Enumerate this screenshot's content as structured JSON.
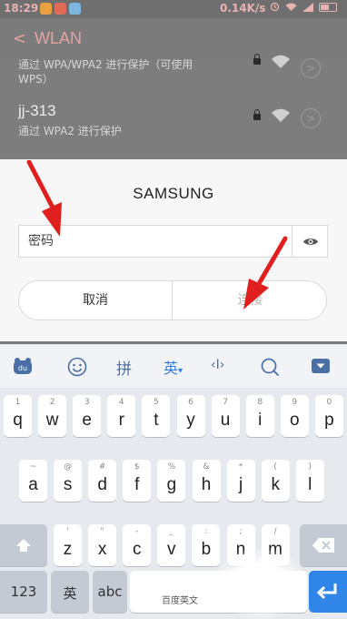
{
  "status_bar": {
    "time": "18:29",
    "speed": "0.14K/s",
    "app_icon_colors": [
      "#e8a040",
      "#e06a58",
      "#7fb6e0"
    ],
    "icons": [
      "alarm-icon",
      "wifi-icon",
      "signal-icon",
      "battery-icon"
    ]
  },
  "wlan": {
    "back_glyph": "<",
    "title": "WLAN",
    "network1_sub_line1": "通过 WPA/WPA2 进行保护（可使用",
    "network1_sub_line2": "WPS）",
    "network2_name": "jj-313",
    "network2_sub": "通过 WPA2 进行保护",
    "info_glyph": ">"
  },
  "dialog": {
    "title": "SAMSUNG",
    "password_placeholder": "密码",
    "cancel_label": "取消",
    "connect_label": "连接"
  },
  "ime_bar": {
    "pinyin_label": "拼",
    "english_label": "英",
    "english_arrow": "▾",
    "cursor_label": "‹I›"
  },
  "keyboard": {
    "row1": [
      {
        "main": "q",
        "sub": "1"
      },
      {
        "main": "w",
        "sub": "2"
      },
      {
        "main": "e",
        "sub": "3"
      },
      {
        "main": "r",
        "sub": "4"
      },
      {
        "main": "t",
        "sub": "5"
      },
      {
        "main": "y",
        "sub": "6"
      },
      {
        "main": "u",
        "sub": "7"
      },
      {
        "main": "i",
        "sub": "8"
      },
      {
        "main": "o",
        "sub": "9"
      },
      {
        "main": "p",
        "sub": "0"
      }
    ],
    "row2": [
      {
        "main": "a",
        "sub": "~"
      },
      {
        "main": "s",
        "sub": "@"
      },
      {
        "main": "d",
        "sub": "#"
      },
      {
        "main": "f",
        "sub": "$"
      },
      {
        "main": "g",
        "sub": "%"
      },
      {
        "main": "h",
        "sub": "&"
      },
      {
        "main": "j",
        "sub": "*"
      },
      {
        "main": "k",
        "sub": "("
      },
      {
        "main": "l",
        "sub": ")"
      }
    ],
    "row3": [
      {
        "main": "z",
        "sub": "'"
      },
      {
        "main": "x",
        "sub": "\""
      },
      {
        "main": "c",
        "sub": "-"
      },
      {
        "main": "v",
        "sub": "_"
      },
      {
        "main": "b",
        "sub": ":"
      },
      {
        "main": "n",
        "sub": ";"
      },
      {
        "main": "m",
        "sub": "/"
      }
    ],
    "num_label": "123",
    "lang_label": "英",
    "abc_label": "abc",
    "space_label": "百度英文"
  },
  "colors": {
    "accent_red": "#e0201f",
    "ime_blue": "#2f7de1",
    "enter_blue": "#2f86e8"
  }
}
